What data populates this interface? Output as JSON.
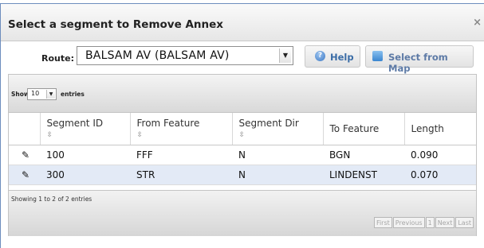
{
  "dialog": {
    "title": "Select a segment to Remove Annex",
    "close_glyph": "×"
  },
  "route": {
    "label": "Route:",
    "value": "BALSAM AV (BALSAM AV)"
  },
  "buttons": {
    "help_label": "Help",
    "select_map_label": "Select from Map"
  },
  "table": {
    "show_label": "Show",
    "page_length": "10",
    "entries_label": "entries",
    "columns": [
      "Segment ID",
      "From Feature",
      "Segment Dir",
      "To Feature",
      "Length"
    ],
    "sort_glyph": "⇳",
    "rows": [
      {
        "segment_id": "100",
        "from_feature": "FFF",
        "segment_dir": "N",
        "to_feature": "BGN",
        "length": "0.090"
      },
      {
        "segment_id": "300",
        "from_feature": "STR",
        "segment_dir": "N",
        "to_feature": "LINDENST",
        "length": "0.070"
      }
    ],
    "info": "Showing 1 to 2 of 2 entries",
    "pagination": {
      "first": "First",
      "previous": "Previous",
      "page": "1",
      "next": "Next",
      "last": "Last"
    }
  },
  "icons": {
    "help": "help-icon",
    "map": "map-icon",
    "edit": "pencil-icon"
  },
  "colors": {
    "accent": "#3a6ca6",
    "selected_row": "#e3eaf6",
    "pencil": "#e6a100"
  }
}
